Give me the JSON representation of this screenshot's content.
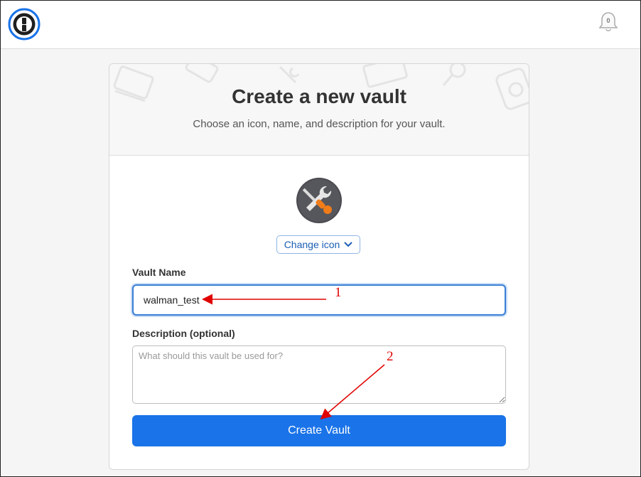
{
  "app": {
    "notifications_count": "0"
  },
  "card": {
    "title": "Create a new vault",
    "subtitle": "Choose an icon, name, and description for your vault.",
    "icon_name": "tools-icon",
    "change_icon_label": "Change icon"
  },
  "form": {
    "vault_name_label": "Vault Name",
    "vault_name_value": "walman_test",
    "description_label": "Description (optional)",
    "description_placeholder": "What should this vault be used for?",
    "description_value": "",
    "submit_label": "Create Vault"
  },
  "annotations": {
    "step1": "1",
    "step2": "2"
  },
  "colors": {
    "accent": "#1a73e8",
    "annotation": "#e00000",
    "icon_orange": "#f07c1a"
  }
}
